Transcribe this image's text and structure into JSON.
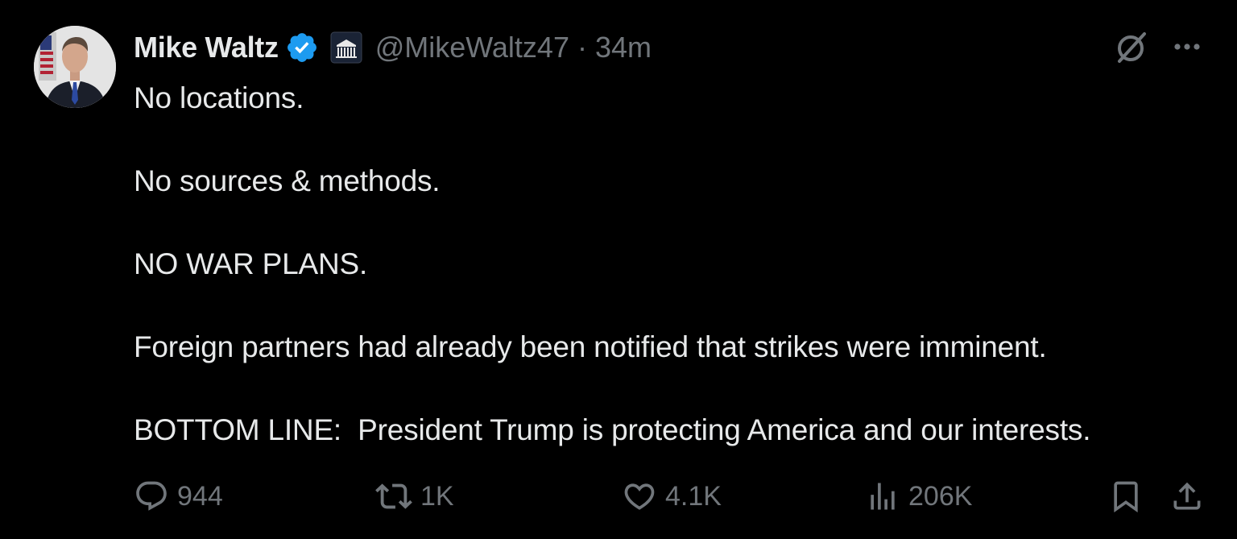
{
  "post": {
    "author_name": "Mike Waltz",
    "handle": "@MikeWaltz47",
    "separator": "·",
    "time_ago": "34m",
    "verified": true,
    "body_lines": [
      "No locations.",
      "No sources & methods.",
      "NO WAR PLANS.",
      "Foreign partners had already been notified that strikes were imminent.",
      "BOTTOM LINE:  President Trump is protecting America and our interests."
    ]
  },
  "metrics": {
    "replies": "944",
    "reposts": "1K",
    "likes": "4.1K",
    "views": "206K"
  },
  "icons": {
    "verified": "verified-badge-icon",
    "affiliate": "white-house-badge-icon",
    "grok": "grok-icon",
    "more": "more-icon",
    "reply": "reply-icon",
    "repost": "repost-icon",
    "like": "heart-icon",
    "views": "views-icon",
    "bookmark": "bookmark-icon",
    "share": "share-icon"
  },
  "colors": {
    "background": "#000000",
    "text": "#e7e9ea",
    "muted": "#71767b",
    "verified": "#1d9bf0"
  }
}
